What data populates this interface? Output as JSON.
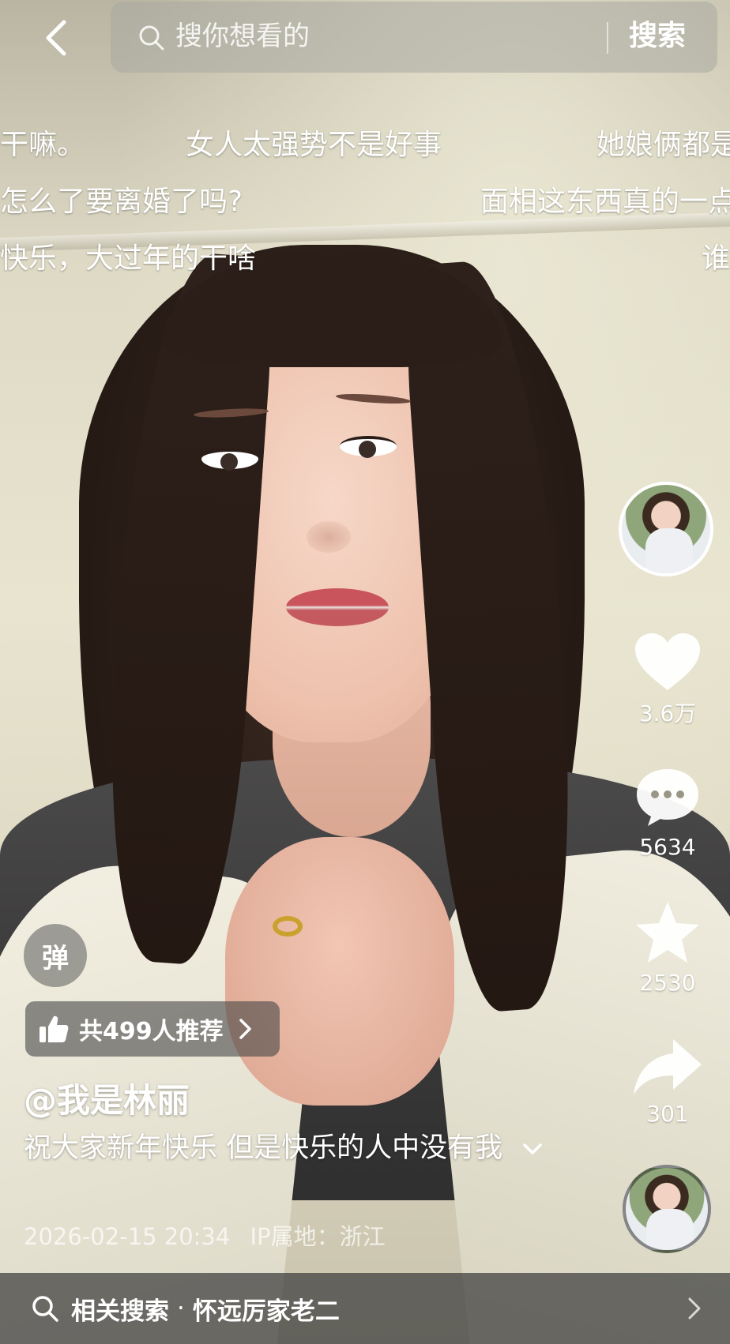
{
  "search": {
    "placeholder": "搜你想看的",
    "button_label": "搜索"
  },
  "danmaku": [
    {
      "text": "干嘛。"
    },
    {
      "text": "女人太强势不是好事"
    },
    {
      "text": "她娘俩都是"
    },
    {
      "text": "怎么了要离婚了吗?"
    },
    {
      "text": "面相这东西真的一点"
    },
    {
      "text": "快乐，大过年的干啥"
    },
    {
      "text": "谁"
    }
  ],
  "actions": {
    "likes": "3.6万",
    "comments": "5634",
    "favorites": "2530",
    "shares": "301"
  },
  "danmu_toggle_label": "弹",
  "recommend": {
    "label": "共499人推荐"
  },
  "post": {
    "author": "@我是林丽",
    "caption": "祝大家新年快乐 但是快乐的人中没有我",
    "timestamp": "2026-02-15 20:34",
    "ip_location": "IP属地：浙江"
  },
  "related_search": {
    "label": "相关搜索",
    "separator": "·",
    "query": "怀远厉家老二"
  },
  "icons": {
    "back": "back-arrow-icon",
    "search": "search-icon",
    "like": "heart-icon",
    "comment": "comment-bubble-icon",
    "favorite": "star-icon",
    "share": "share-arrow-icon",
    "recommend": "thumbs-up-icon",
    "expand": "chevron-down-icon",
    "related_arrow": "chevron-right-icon"
  },
  "colors": {
    "overlay_text": "#ffffff",
    "search_box": "#aaaaa0",
    "ring": "#c9a12c"
  }
}
